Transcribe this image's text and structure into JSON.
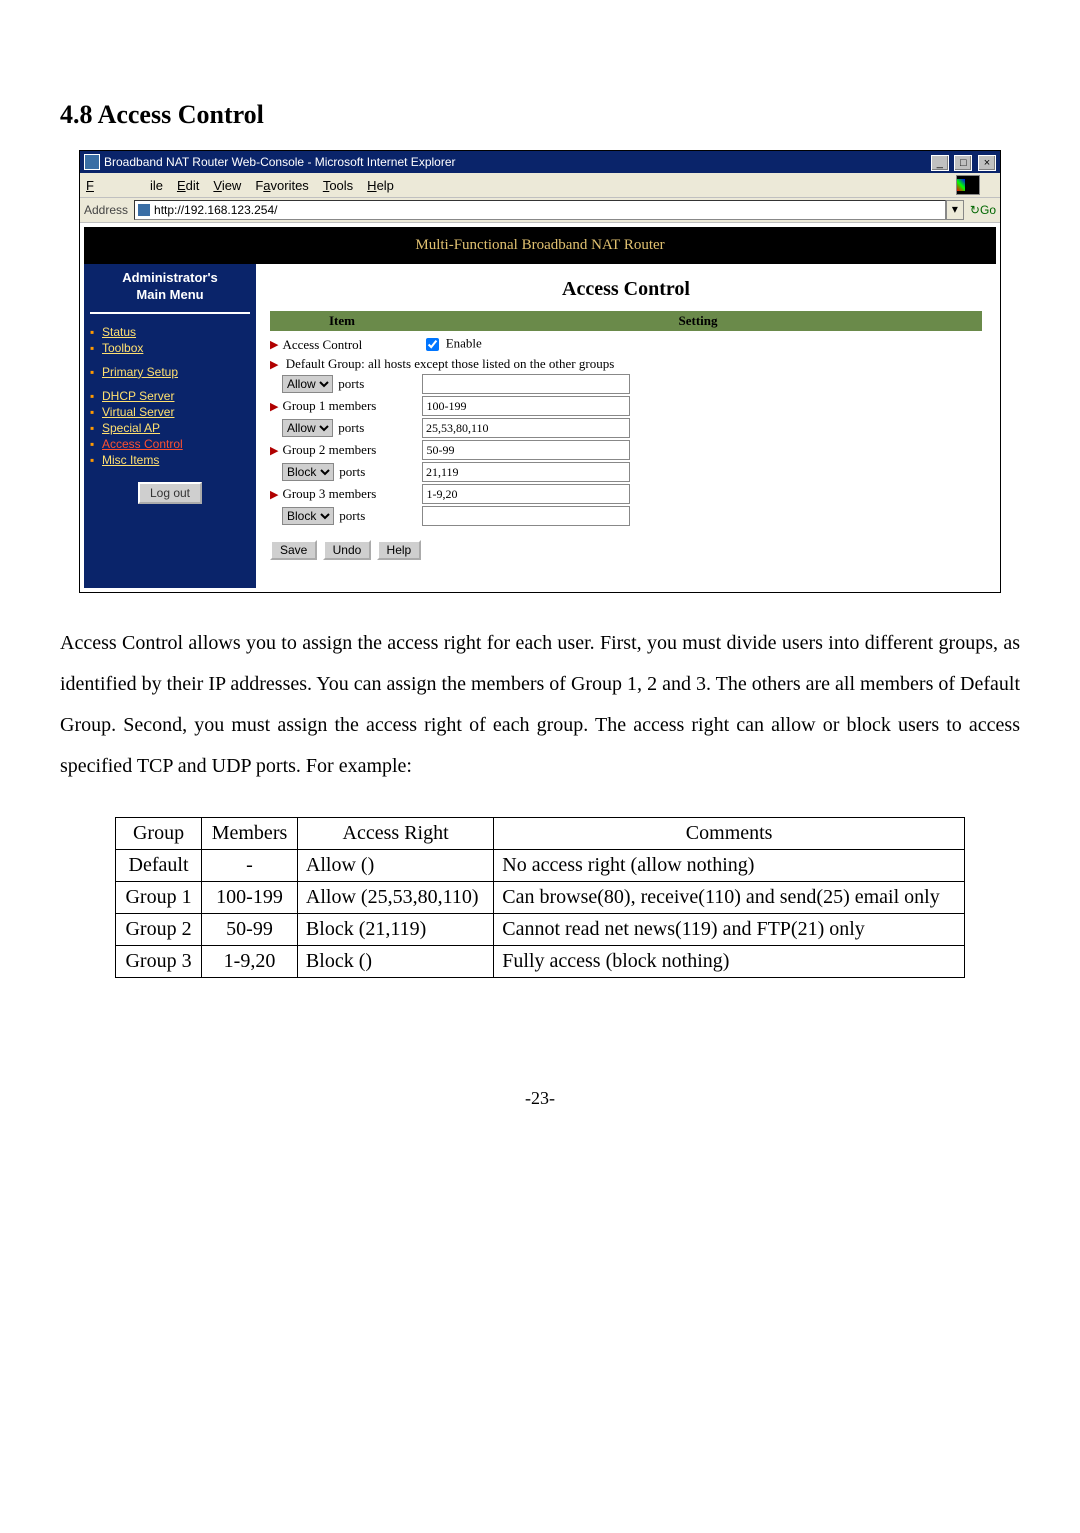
{
  "section": {
    "number": "4.8",
    "title": "Access Control"
  },
  "browser": {
    "title": "Broadband NAT Router Web-Console - Microsoft Internet Explorer",
    "menus": {
      "file": "File",
      "edit": "Edit",
      "view": "View",
      "favorites": "Favorites",
      "tools": "Tools",
      "help": "Help"
    },
    "address_label": "Address",
    "url": "http://192.168.123.254/",
    "go": "Go"
  },
  "page": {
    "banner": "Multi-Functional Broadband NAT Router",
    "sidebar_title_1": "Administrator's",
    "sidebar_title_2": "Main Menu",
    "nav": {
      "status": "Status",
      "toolbox": "Toolbox",
      "primary": "Primary Setup",
      "dhcp": "DHCP Server",
      "virtual": "Virtual Server",
      "special": "Special AP",
      "access": "Access Control",
      "misc": "Misc Items"
    },
    "logout": "Log out",
    "main_title": "Access Control",
    "th_item": "Item",
    "th_setting": "Setting",
    "rows": {
      "access_control_label": "Access Control",
      "enable_label": "Enable",
      "default_group_note": "Default Group: all hosts except those listed on the other groups",
      "ports_label": "ports",
      "group1_label": "Group 1 members",
      "group2_label": "Group 2 members",
      "group3_label": "Group 3 members",
      "allow_option": "Allow",
      "block_option": "Block",
      "default_ports_select": "Allow",
      "default_ports_value": "",
      "g1_members_value": "100-199",
      "g1_ports_select": "Allow",
      "g1_ports_value": "25,53,80,110",
      "g2_members_value": "50-99",
      "g2_ports_select": "Block",
      "g2_ports_value": "21,119",
      "g3_members_value": "1-9,20",
      "g3_ports_select": "Block",
      "g3_ports_value": ""
    },
    "buttons": {
      "save": "Save",
      "undo": "Undo",
      "help": "Help"
    }
  },
  "paragraph": "Access Control allows you to assign the access right for each user. First, you must divide users into different groups, as identified by their IP addresses. You can assign the members of Group 1, 2 and 3. The others are all members of Default Group. Second, you must assign the access right of each group. The access right can allow or block users to access specified TCP and UDP ports. For example:",
  "table": {
    "headers": {
      "group": "Group",
      "members": "Members",
      "right": "Access Right",
      "comments": "Comments"
    },
    "rows": [
      {
        "group": "Default",
        "members": "-",
        "right": "Allow ()",
        "comments": "No access right (allow nothing)"
      },
      {
        "group": "Group 1",
        "members": "100-199",
        "right": "Allow (25,53,80,110)",
        "comments": "Can browse(80), receive(110) and send(25) email only"
      },
      {
        "group": "Group 2",
        "members": "50-99",
        "right": "Block (21,119)",
        "comments": "Cannot read net news(119) and FTP(21) only"
      },
      {
        "group": "Group 3",
        "members": "1-9,20",
        "right": "Block ()",
        "comments": "Fully access (block nothing)"
      }
    ]
  },
  "page_number": "-23-"
}
